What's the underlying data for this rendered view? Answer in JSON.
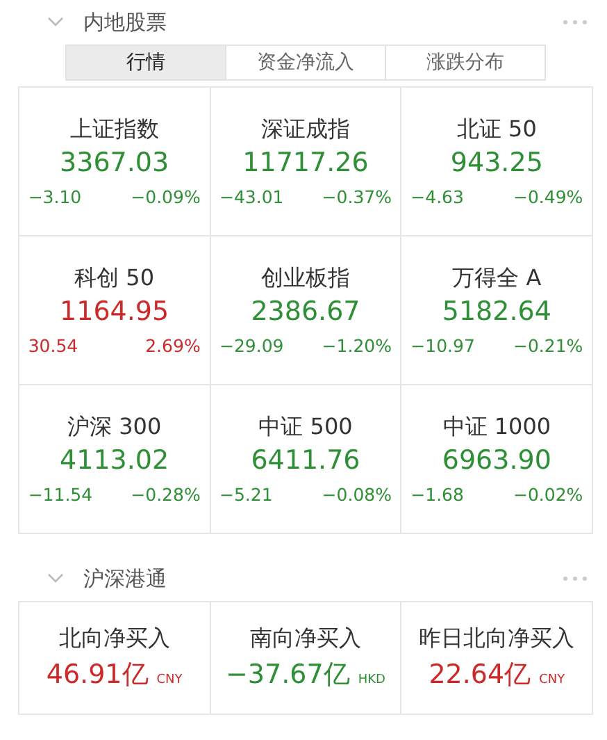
{
  "sections": [
    {
      "title": "内地股票",
      "expanded": true,
      "tabs": [
        {
          "label": "行情",
          "selected": true
        },
        {
          "label": "资金净流入",
          "selected": false
        },
        {
          "label": "涨跌分布",
          "selected": false
        }
      ],
      "cards": [
        {
          "name": "上证指数",
          "value": "3367.03",
          "change": "−3.10",
          "percent": "−0.09%",
          "color": "#2f8f36"
        },
        {
          "name": "深证成指",
          "value": "11717.26",
          "change": "−43.01",
          "percent": "−0.37%",
          "color": "#2f8f36"
        },
        {
          "name": "北证 50",
          "value": "943.25",
          "change": "−4.63",
          "percent": "−0.49%",
          "color": "#2f8f36"
        },
        {
          "name": "科创 50",
          "value": "1164.95",
          "change": "30.54",
          "percent": "2.69%",
          "color": "#cc2a2a"
        },
        {
          "name": "创业板指",
          "value": "2386.67",
          "change": "−29.09",
          "percent": "−1.20%",
          "color": "#2f8f36"
        },
        {
          "name": "万得全 A",
          "value": "5182.64",
          "change": "−10.97",
          "percent": "−0.21%",
          "color": "#2f8f36"
        },
        {
          "name": "沪深 300",
          "value": "4113.02",
          "change": "−11.54",
          "percent": "−0.28%",
          "color": "#2f8f36"
        },
        {
          "name": "中证 500",
          "value": "6411.76",
          "change": "−5.21",
          "percent": "−0.08%",
          "color": "#2f8f36"
        },
        {
          "name": "中证 1000",
          "value": "6963.90",
          "change": "−1.68",
          "percent": "−0.02%",
          "color": "#2f8f36"
        }
      ]
    },
    {
      "title": "沪深港通",
      "expanded": true,
      "cards": [
        {
          "name": "北向净买入",
          "value": "46.91亿",
          "currency": "CNY",
          "color": "#cc2a2a"
        },
        {
          "name": "南向净买入",
          "value": "−37.67亿",
          "currency": "HKD",
          "color": "#2f8f36"
        },
        {
          "name": "昨日北向净买入",
          "value": "22.64亿",
          "currency": "CNY",
          "color": "#cc2a2a"
        }
      ]
    }
  ]
}
